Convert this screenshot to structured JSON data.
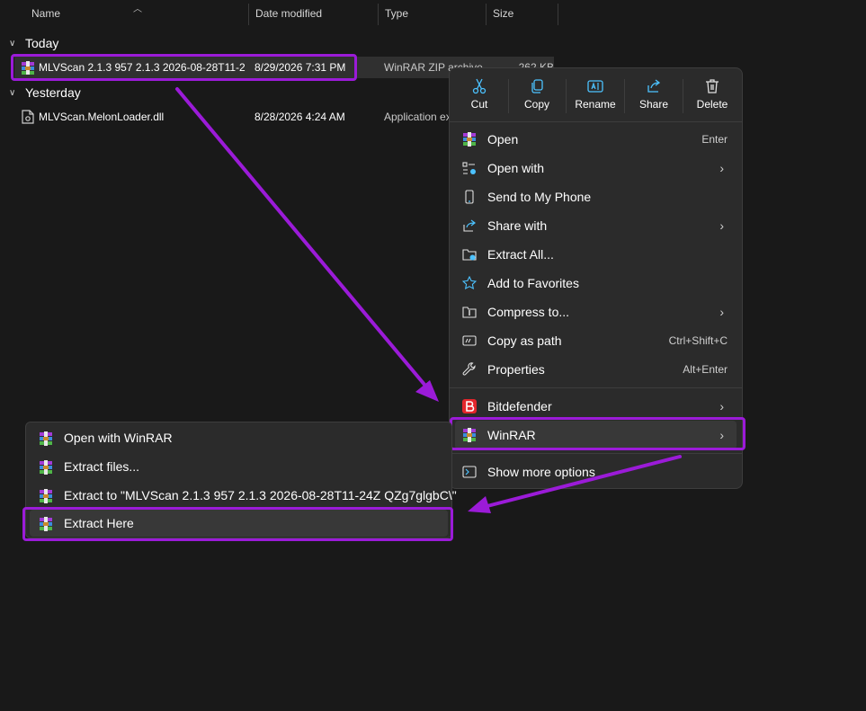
{
  "columns": {
    "name": "Name",
    "date_modified": "Date modified",
    "type": "Type",
    "size": "Size"
  },
  "groups": [
    {
      "label": "Today",
      "files": [
        {
          "name": "MLVScan 2.1.3 957 2.1.3 2026-08-28T11-2...",
          "date": "8/29/2026 7:31 PM",
          "type": "WinRAR ZIP archive",
          "size": "262 KB",
          "icon": "winrar-archive-icon"
        }
      ]
    },
    {
      "label": "Yesterday",
      "files": [
        {
          "name": "MLVScan.MelonLoader.dll",
          "date": "8/28/2026 4:24 AM",
          "type": "Application ex",
          "size": "",
          "icon": "dll-file-icon"
        }
      ]
    }
  ],
  "context_menu": {
    "quick_actions": [
      {
        "label": "Cut",
        "icon": "scissors-icon"
      },
      {
        "label": "Copy",
        "icon": "copy-icon"
      },
      {
        "label": "Rename",
        "icon": "rename-icon"
      },
      {
        "label": "Share",
        "icon": "share-icon"
      },
      {
        "label": "Delete",
        "icon": "trash-icon"
      }
    ],
    "items": [
      {
        "label": "Open",
        "shortcut": "Enter",
        "icon": "winrar-icon"
      },
      {
        "label": "Open with",
        "shortcut": "",
        "icon": "open-with-icon",
        "submenu": true
      },
      {
        "label": "Send to My Phone",
        "shortcut": "",
        "icon": "phone-icon"
      },
      {
        "label": "Share with",
        "shortcut": "",
        "icon": "share-with-icon",
        "submenu": true
      },
      {
        "label": "Extract All...",
        "shortcut": "",
        "icon": "extract-all-icon"
      },
      {
        "label": "Add to Favorites",
        "shortcut": "",
        "icon": "star-icon"
      },
      {
        "label": "Compress to...",
        "shortcut": "",
        "icon": "compress-icon",
        "submenu": true
      },
      {
        "label": "Copy as path",
        "shortcut": "Ctrl+Shift+C",
        "icon": "copy-path-icon"
      },
      {
        "label": "Properties",
        "shortcut": "Alt+Enter",
        "icon": "wrench-icon"
      },
      {
        "label": "Bitdefender",
        "shortcut": "",
        "icon": "bitdefender-icon",
        "submenu": true
      },
      {
        "label": "WinRAR",
        "shortcut": "",
        "icon": "winrar-icon",
        "submenu": true
      },
      {
        "label": "Show more options",
        "shortcut": "",
        "icon": "more-options-icon"
      }
    ],
    "chevron": "›"
  },
  "winrar_submenu": {
    "items": [
      {
        "label": "Open with WinRAR"
      },
      {
        "label": "Extract files..."
      },
      {
        "label": "Extract to \"MLVScan 2.1.3 957 2.1.3 2026-08-28T11-24Z QZg7glgbC\\\""
      },
      {
        "label": "Extract Here"
      }
    ]
  },
  "colors": {
    "background": "#191919",
    "menu_bg": "#2b2b2b",
    "highlight_border": "#9b1bd8",
    "arrow": "#9b1bd8",
    "accent_blue": "#4cc2ff",
    "bitdefender_red": "#e4262c"
  }
}
